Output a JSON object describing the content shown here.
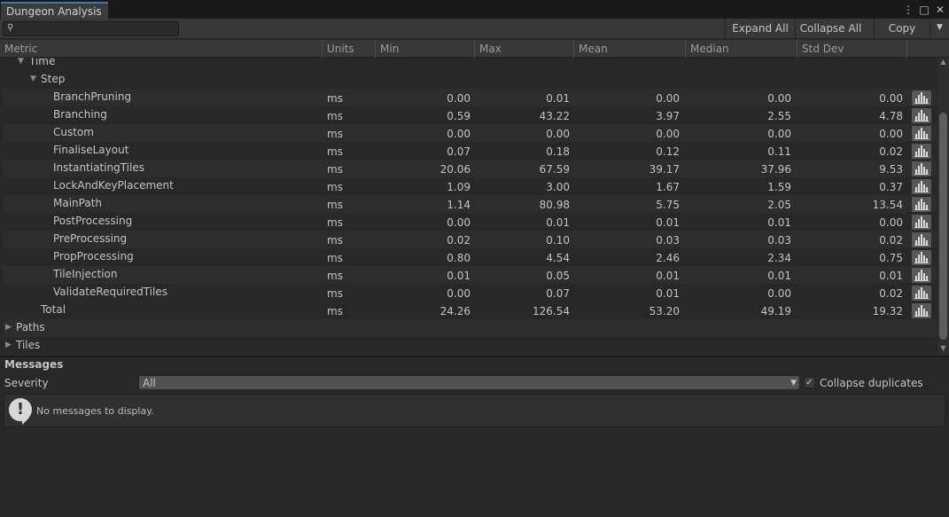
{
  "window": {
    "tab_title": "Dungeon Analysis"
  },
  "icons": {
    "menu": "kebab-menu-icon",
    "maximize": "maximize-icon",
    "close": "close-icon",
    "search": "magnifier-icon",
    "graph": "bar-chart-icon",
    "info": "exclamation-bubble-icon"
  },
  "toolbar": {
    "search_value": "",
    "expand_all": "Expand All",
    "collapse_all": "Collapse All",
    "copy": "Copy"
  },
  "columns": [
    "Metric",
    "Units",
    "Min",
    "Max",
    "Mean",
    "Median",
    "Std Dev"
  ],
  "tree": {
    "time_label": "Time",
    "step_label": "Step",
    "rows": [
      {
        "name": "BranchPruning",
        "units": "ms",
        "min": "0.00",
        "max": "0.01",
        "mean": "0.00",
        "median": "0.00",
        "std": "0.00"
      },
      {
        "name": "Branching",
        "units": "ms",
        "min": "0.59",
        "max": "43.22",
        "mean": "3.97",
        "median": "2.55",
        "std": "4.78"
      },
      {
        "name": "Custom",
        "units": "ms",
        "min": "0.00",
        "max": "0.00",
        "mean": "0.00",
        "median": "0.00",
        "std": "0.00"
      },
      {
        "name": "FinaliseLayout",
        "units": "ms",
        "min": "0.07",
        "max": "0.18",
        "mean": "0.12",
        "median": "0.11",
        "std": "0.02"
      },
      {
        "name": "InstantiatingTiles",
        "units": "ms",
        "min": "20.06",
        "max": "67.59",
        "mean": "39.17",
        "median": "37.96",
        "std": "9.53"
      },
      {
        "name": "LockAndKeyPlacement",
        "units": "ms",
        "min": "1.09",
        "max": "3.00",
        "mean": "1.67",
        "median": "1.59",
        "std": "0.37"
      },
      {
        "name": "MainPath",
        "units": "ms",
        "min": "1.14",
        "max": "80.98",
        "mean": "5.75",
        "median": "2.05",
        "std": "13.54"
      },
      {
        "name": "PostProcessing",
        "units": "ms",
        "min": "0.00",
        "max": "0.01",
        "mean": "0.01",
        "median": "0.01",
        "std": "0.00"
      },
      {
        "name": "PreProcessing",
        "units": "ms",
        "min": "0.02",
        "max": "0.10",
        "mean": "0.03",
        "median": "0.03",
        "std": "0.02"
      },
      {
        "name": "PropProcessing",
        "units": "ms",
        "min": "0.80",
        "max": "4.54",
        "mean": "2.46",
        "median": "2.34",
        "std": "0.75"
      },
      {
        "name": "TileInjection",
        "units": "ms",
        "min": "0.01",
        "max": "0.05",
        "mean": "0.01",
        "median": "0.01",
        "std": "0.01"
      },
      {
        "name": "ValidateRequiredTiles",
        "units": "ms",
        "min": "0.00",
        "max": "0.07",
        "mean": "0.01",
        "median": "0.00",
        "std": "0.02"
      }
    ],
    "total": {
      "name": "Total",
      "units": "ms",
      "min": "24.26",
      "max": "126.54",
      "mean": "53.20",
      "median": "49.19",
      "std": "19.32"
    },
    "paths_label": "Paths",
    "tiles_label": "Tiles"
  },
  "messages": {
    "title": "Messages",
    "severity_label": "Severity",
    "severity_value": "All",
    "collapse_label": "Collapse duplicates",
    "collapse_checked": true,
    "empty_text": "No messages to display."
  }
}
